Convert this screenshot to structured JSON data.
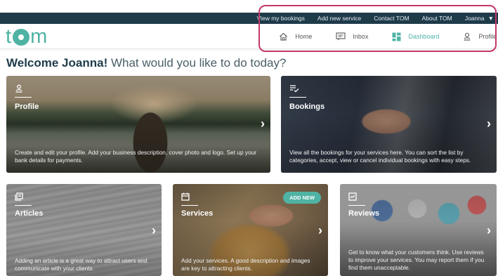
{
  "topbar": {
    "links": [
      "View my bookings",
      "Add new service",
      "Contact TOM",
      "About TOM"
    ],
    "user": "Joanna"
  },
  "logo": {
    "t": "t",
    "m": "m"
  },
  "nav": {
    "home": "Home",
    "inbox": "Inbox",
    "dashboard": "Dashboard",
    "profile": "Profile"
  },
  "welcome": {
    "name": "Welcome Joanna!",
    "rest": " What would you like to do today?"
  },
  "cards": {
    "profile": {
      "title": "Profile",
      "desc": "Create and edit your profile. Add your business description, cover photo and logo. Set up your bank details for payments."
    },
    "bookings": {
      "title": "Bookings",
      "desc": "View all the bookings for your services here. You can sort the list by categories, accept, view or cancel individual bookings with easy steps."
    },
    "articles": {
      "title": "Articles",
      "desc": "Adding an article is a great way to attract users and communicate with your clients."
    },
    "services": {
      "title": "Services",
      "badge": "ADD NEW",
      "desc": "Add your services. A good description and images are key to attracting clients."
    },
    "reviews": {
      "title": "Reviews",
      "desc": "Get to know what your customers think. Use reviews to improve your services. You may report them if you find them unacceptable."
    }
  },
  "colors": {
    "accent": "#4fb3a4",
    "topbar": "#1e3b4a",
    "highlight": "#c2376a"
  }
}
